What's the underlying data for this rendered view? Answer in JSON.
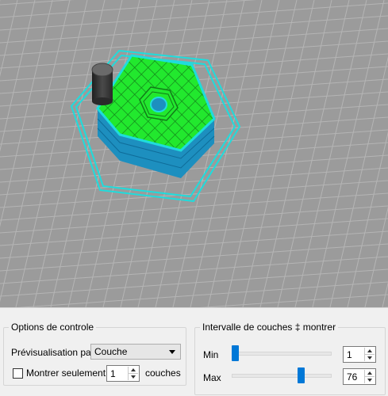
{
  "viewport": {
    "background": "#9b9b9b",
    "grid_color": "#b5b5b5",
    "model_colors": {
      "infill": "#22e82e",
      "walls": "#1d8fbf",
      "outline": "#1fdcdc",
      "purge_tower": "#3a3a3a"
    }
  },
  "control_options": {
    "title": "Options de controle",
    "preview_label": "Prévisualisation par",
    "preview_value": "Couche",
    "show_only_label": "Montrer seulement",
    "show_only_checked": false,
    "show_only_count": "1",
    "layers_label": "couches"
  },
  "layer_range": {
    "title": "Intervalle de couches ‡ montrer",
    "min_label": "Min",
    "min_value": "1",
    "min_fraction": 0.0,
    "max_label": "Max",
    "max_value": "76",
    "max_fraction": 0.71
  }
}
